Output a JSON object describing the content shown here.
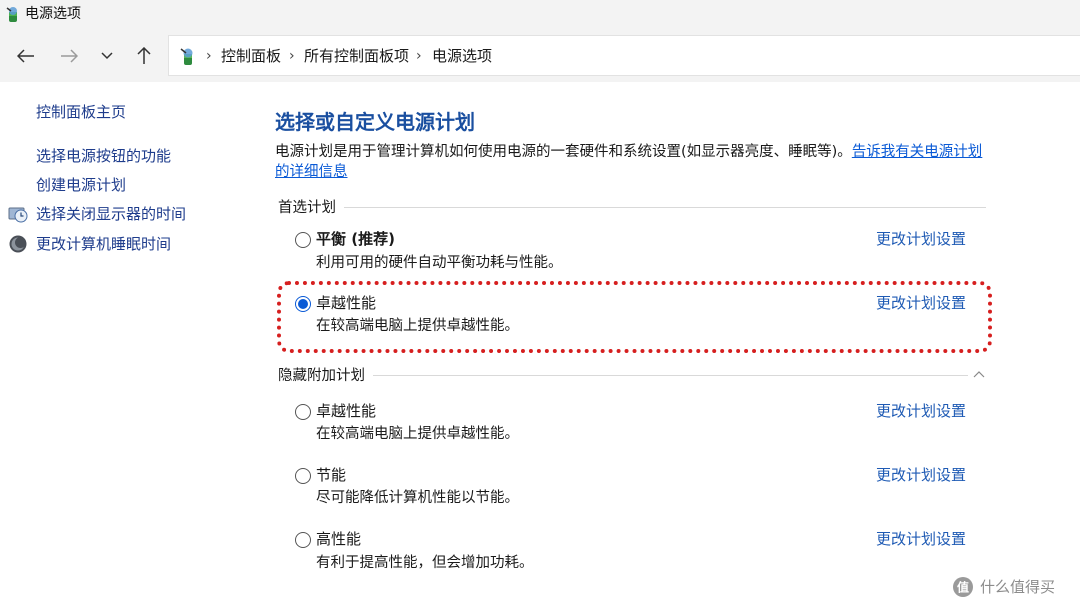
{
  "window": {
    "title": "电源选项"
  },
  "nav": {
    "breadcrumb": [
      "控制面板",
      "所有控制面板项",
      "电源选项"
    ],
    "separator": "›"
  },
  "sidebar": {
    "home": "控制面板主页",
    "items": [
      {
        "label": "选择电源按钮的功能",
        "icon": ""
      },
      {
        "label": "创建电源计划",
        "icon": ""
      },
      {
        "label": "选择关闭显示器的时间",
        "icon": "monitor-clock-icon"
      },
      {
        "label": "更改计算机睡眠时间",
        "icon": "moon-icon"
      }
    ]
  },
  "main": {
    "title": "选择或自定义电源计划",
    "description": "电源计划是用于管理计算机如何使用电源的一套硬件和系统设置(如显示器亮度、睡眠等)。",
    "description_link": "告诉我有关电源计划的详细信息",
    "preferred_label": "首选计划",
    "hidden_label": "隐藏附加计划",
    "plans": [
      {
        "name": "平衡 (推荐)",
        "desc": "利用可用的硬件自动平衡功耗与性能。",
        "link": "更改计划设置",
        "selected": false
      },
      {
        "name": "卓越性能",
        "desc": "在较高端电脑上提供卓越性能。",
        "link": "更改计划设置",
        "selected": true
      },
      {
        "name": "卓越性能",
        "desc": "在较高端电脑上提供卓越性能。",
        "link": "更改计划设置",
        "selected": false
      },
      {
        "name": "节能",
        "desc": "尽可能降低计算机性能以节能。",
        "link": "更改计划设置",
        "selected": false
      },
      {
        "name": "高性能",
        "desc": "有利于提高性能，但会增加功耗。",
        "link": "更改计划设置",
        "selected": false
      }
    ]
  },
  "watermark": {
    "text": "什么值得买"
  },
  "colors": {
    "link": "#1e5ab4",
    "title": "#1a4fa0",
    "accent": "#0a5ad6",
    "highlight": "#d61f1f"
  }
}
